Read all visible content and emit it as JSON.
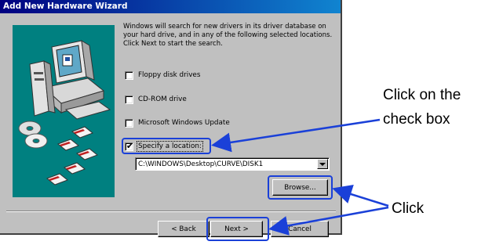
{
  "window": {
    "title": "Add New Hardware Wizard"
  },
  "description": "Windows will search for new drivers in its driver database on your hard drive, and in any of the following selected locations. Click Next to start the search.",
  "options": [
    {
      "label": "Floppy disk drives",
      "checked": false
    },
    {
      "label": "CD-ROM drive",
      "checked": false
    },
    {
      "label": "Microsoft Windows Update",
      "checked": false
    },
    {
      "label": "Specify a location:",
      "checked": true
    }
  ],
  "location": {
    "value": "C:\\WINDOWS\\Desktop\\CURVE\\DISK1"
  },
  "buttons": {
    "browse": "Browse...",
    "back": "< Back",
    "next": "Next >",
    "cancel": "Cancel"
  },
  "annotations": {
    "checkbox_note_line1": "Click on the",
    "checkbox_note_line2": "check box",
    "click_note": "Click"
  },
  "colors": {
    "titlebar": "#000080",
    "dialog_face": "#c0c0c0",
    "illustration_bg": "#008080",
    "highlight": "#1a40d8"
  }
}
